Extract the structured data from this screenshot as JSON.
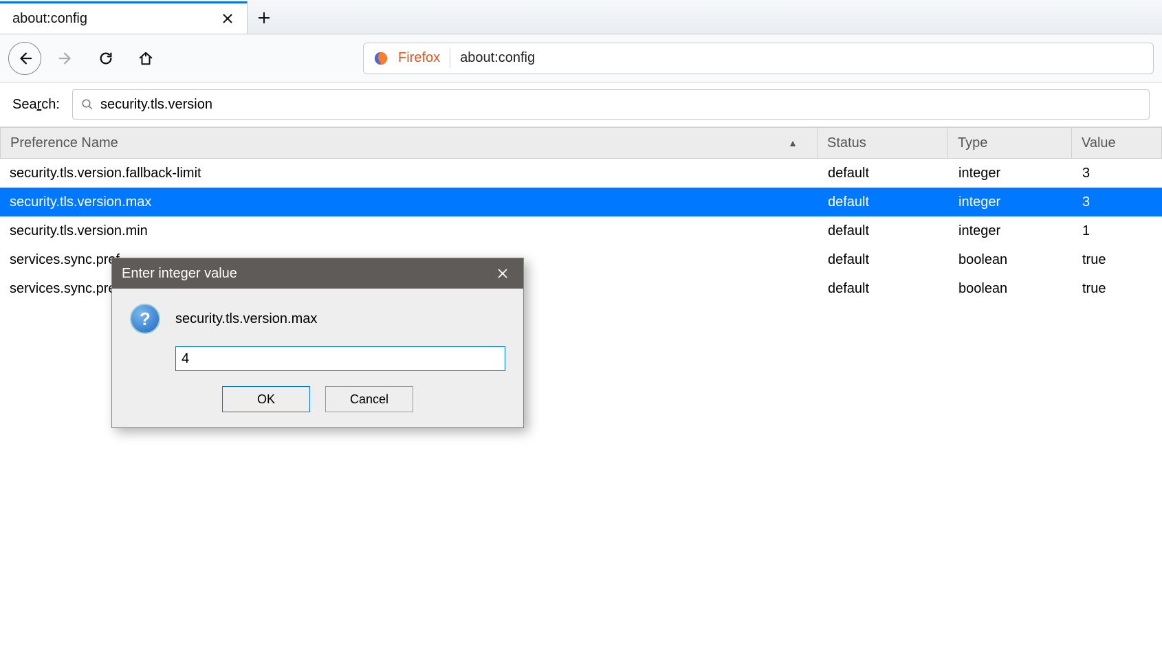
{
  "tab": {
    "title": "about:config"
  },
  "urlbar": {
    "brand": "Firefox",
    "url": "about:config"
  },
  "search": {
    "label_pre": "Sea",
    "label_accel": "r",
    "label_post": "ch:",
    "value": "security.tls.version"
  },
  "columns": {
    "name": "Preference Name",
    "status": "Status",
    "type": "Type",
    "value": "Value"
  },
  "rows": [
    {
      "name": "security.tls.version.fallback-limit",
      "status": "default",
      "type": "integer",
      "value": "3",
      "selected": false
    },
    {
      "name": "security.tls.version.max",
      "status": "default",
      "type": "integer",
      "value": "3",
      "selected": true
    },
    {
      "name": "security.tls.version.min",
      "status": "default",
      "type": "integer",
      "value": "1",
      "selected": false
    },
    {
      "name": "services.sync.prefs.sync.security.tls.version.max",
      "status": "default",
      "type": "boolean",
      "value": "true",
      "selected": false,
      "clip": "services.sync.pref"
    },
    {
      "name": "services.sync.prefs.sync.security.tls.version.min",
      "status": "default",
      "type": "boolean",
      "value": "true",
      "selected": false,
      "clip": "services.sync.pref"
    }
  ],
  "dialog": {
    "title": "Enter integer value",
    "pref_name": "security.tls.version.max",
    "input_value": "4",
    "ok": "OK",
    "cancel": "Cancel"
  }
}
